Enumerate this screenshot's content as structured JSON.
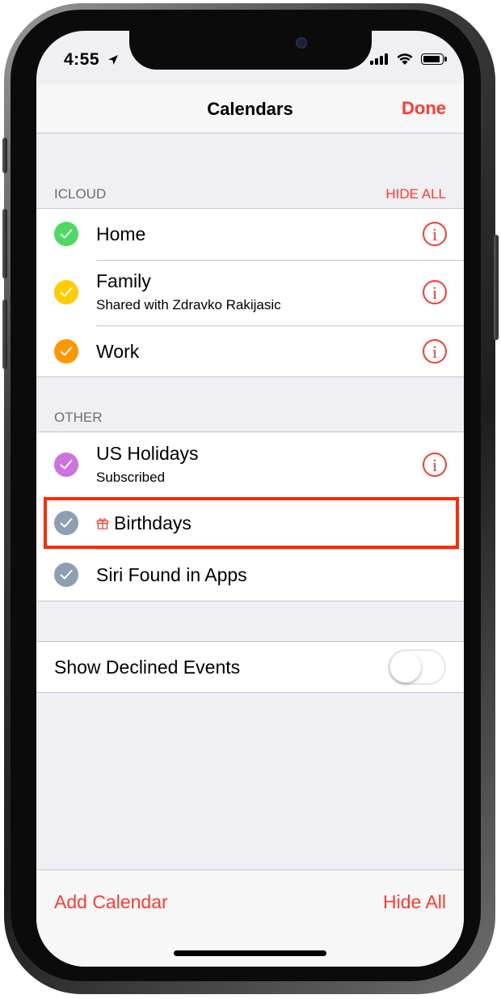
{
  "status_bar": {
    "time": "4:55"
  },
  "nav": {
    "title": "Calendars",
    "done_label": "Done"
  },
  "sections": {
    "icloud": {
      "header": "ICLOUD",
      "action": "HIDE ALL",
      "items": [
        {
          "title": "Home",
          "subtitle": "",
          "color": "#4cd964"
        },
        {
          "title": "Family",
          "subtitle": "Shared with Zdravko Rakijasic",
          "color": "#ffcc00"
        },
        {
          "title": "Work",
          "subtitle": "",
          "color": "#ff9500"
        }
      ]
    },
    "other": {
      "header": "OTHER",
      "items": [
        {
          "title": "US Holidays",
          "subtitle": "Subscribed",
          "color": "#cc73e1"
        },
        {
          "title": "Birthdays",
          "subtitle": "",
          "color": "#8e9fb4",
          "icon": "gift-icon"
        },
        {
          "title": "Siri Found in Apps",
          "subtitle": "",
          "color": "#8e9fb4"
        }
      ]
    }
  },
  "settings": {
    "show_declined_label": "Show Declined Events",
    "show_declined_on": false
  },
  "toolbar": {
    "add_calendar_label": "Add Calendar",
    "hide_all_label": "Hide All"
  },
  "colors": {
    "accent": "#ff3b30",
    "highlight": "#ff2a00",
    "background": "#efeff4"
  },
  "icons": {
    "info": "i"
  }
}
